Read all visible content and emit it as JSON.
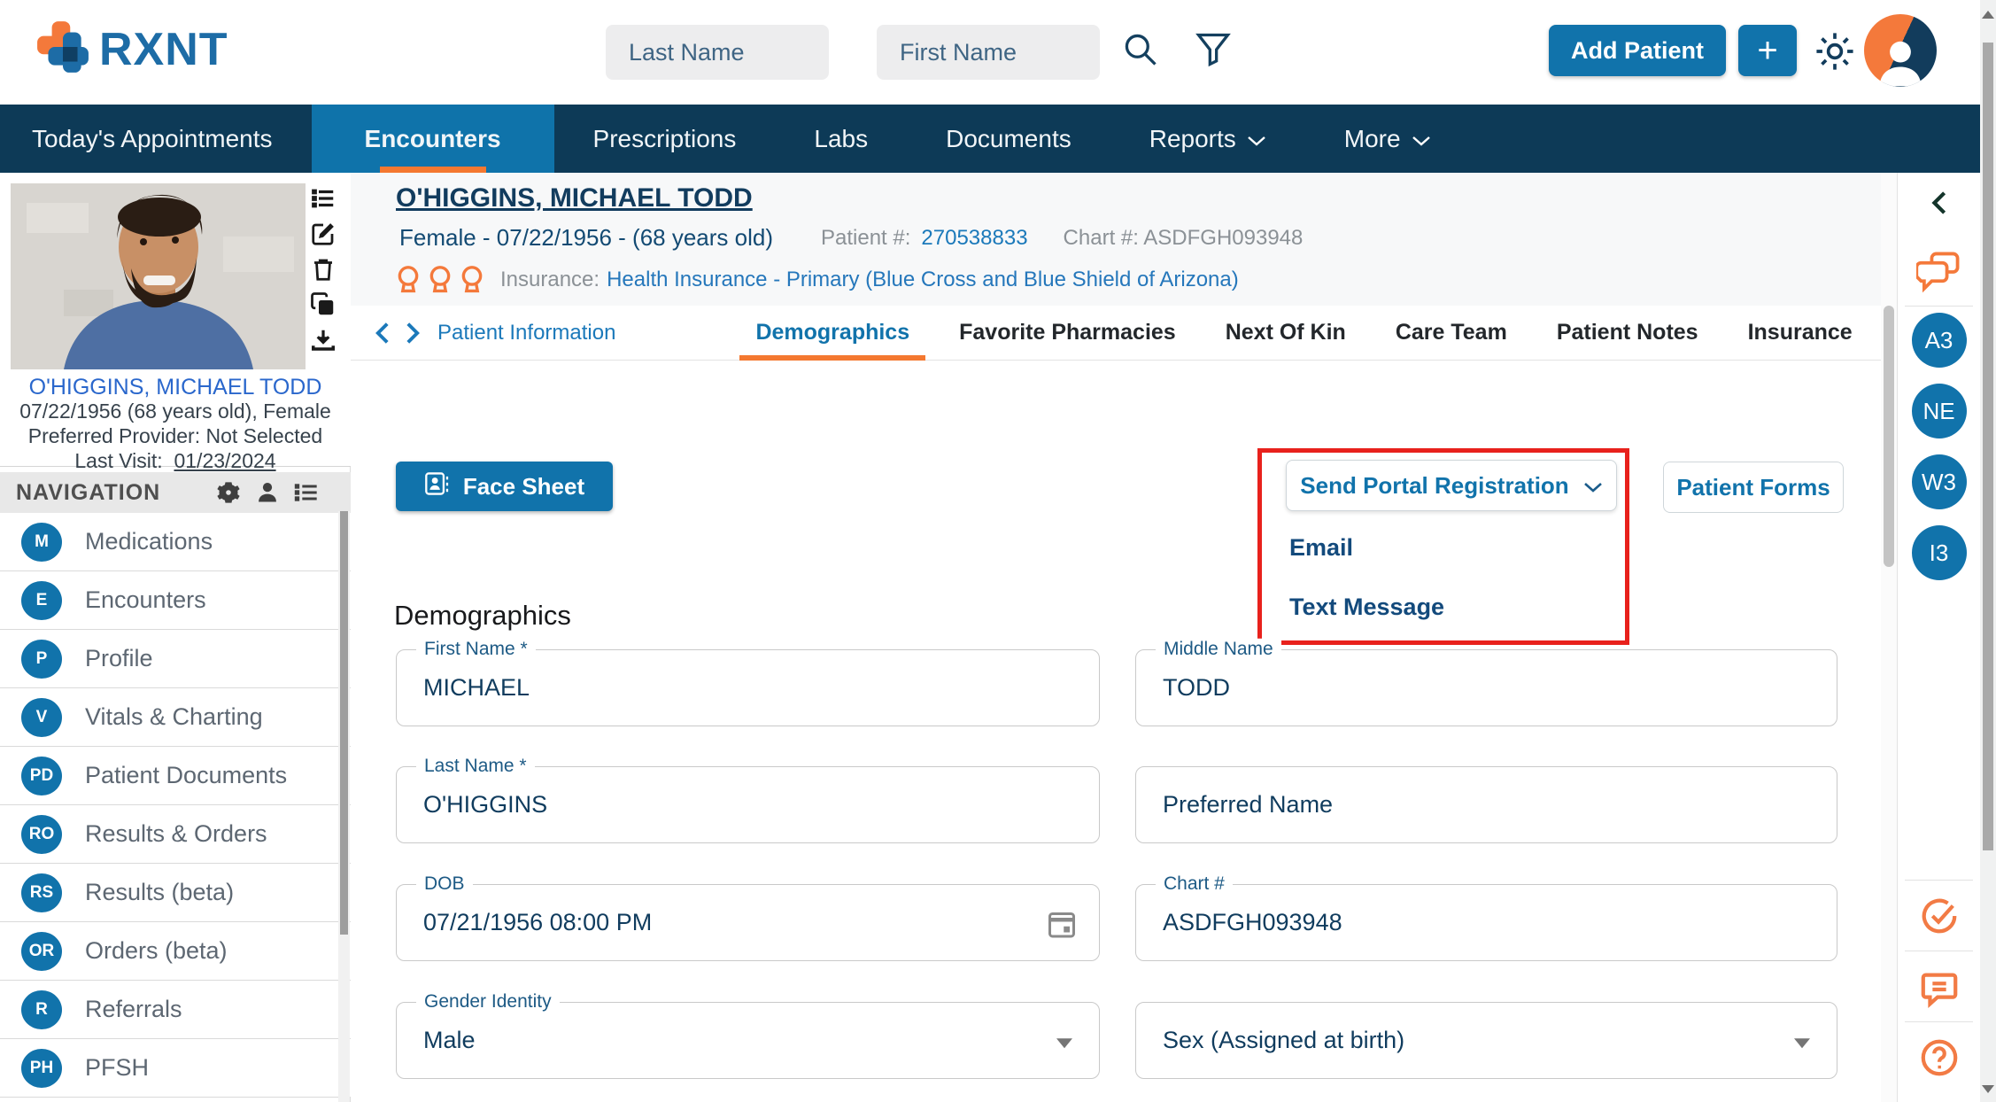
{
  "colors": {
    "navy": "#0d3a57",
    "active_tab": "#0f73aa",
    "brand_blue": "#1d6ca6",
    "button_blue": "#1173ab",
    "orange": "#f47830",
    "annotation_red": "#e8211c",
    "link_blue": "#1b79ba"
  },
  "header": {
    "brand": "RXNT",
    "search": {
      "last_name_placeholder": "Last Name",
      "first_name_placeholder": "First Name"
    },
    "add_patient_label": "Add Patient",
    "plus_label": "+"
  },
  "nav": {
    "items": [
      {
        "label": "Today's Appointments"
      },
      {
        "label": "Encounters"
      },
      {
        "label": "Prescriptions"
      },
      {
        "label": "Labs"
      },
      {
        "label": "Documents"
      },
      {
        "label": "Reports"
      },
      {
        "label": "More"
      }
    ]
  },
  "sidebar": {
    "patient_card": {
      "name": "O'HIGGINS, MICHAEL TODD",
      "dob_line": "07/22/1956 (68 years old), Female",
      "provider_line": "Preferred Provider: Not Selected",
      "last_visit_label": "Last Visit:",
      "last_visit_date": "01/23/2024"
    },
    "navigation_title": "NAVIGATION",
    "items": [
      {
        "badge": "M",
        "label": "Medications"
      },
      {
        "badge": "E",
        "label": "Encounters"
      },
      {
        "badge": "P",
        "label": "Profile"
      },
      {
        "badge": "V",
        "label": "Vitals & Charting"
      },
      {
        "badge": "PD",
        "label": "Patient Documents"
      },
      {
        "badge": "RO",
        "label": "Results & Orders"
      },
      {
        "badge": "RS",
        "label": "Results (beta)"
      },
      {
        "badge": "OR",
        "label": "Orders (beta)"
      },
      {
        "badge": "R",
        "label": "Referrals"
      },
      {
        "badge": "PH",
        "label": "PFSH"
      }
    ]
  },
  "patient_header": {
    "name": "O'HIGGINS, MICHAEL TODD",
    "summary": "Female - 07/22/1956 - (68 years old)",
    "patient_number_label": "Patient #:",
    "patient_number": "270538833",
    "chart_text": "Chart #: ASDFGH093948",
    "insurance_label": "Insurance:",
    "insurance_value": "Health Insurance - Primary (Blue Cross and Blue Shield of Arizona)"
  },
  "tab_row": {
    "context_label": "Patient Information",
    "tabs": [
      {
        "label": "Demographics"
      },
      {
        "label": "Favorite Pharmacies"
      },
      {
        "label": "Next Of Kin"
      },
      {
        "label": "Care Team"
      },
      {
        "label": "Patient Notes"
      },
      {
        "label": "Insurance"
      }
    ]
  },
  "content": {
    "face_sheet_label": "Face Sheet",
    "send_portal_label": "Send Portal Registration",
    "portal_menu": [
      "Email",
      "Text Message"
    ],
    "patient_forms_label": "Patient Forms",
    "section_title": "Demographics",
    "fields": {
      "first_name": {
        "label": "First Name *",
        "value": "MICHAEL"
      },
      "middle_name": {
        "label": "Middle Name",
        "value": "TODD"
      },
      "last_name": {
        "label": "Last Name *",
        "value": "O'HIGGINS"
      },
      "preferred_name": {
        "placeholder": "Preferred Name",
        "value": ""
      },
      "dob": {
        "label": "DOB",
        "value": "07/21/1956 08:00 PM"
      },
      "chart": {
        "label": "Chart #",
        "value": "ASDFGH093948"
      },
      "gender_identity": {
        "label": "Gender Identity",
        "value": "Male"
      },
      "sex": {
        "placeholder": "Sex (Assigned at birth)",
        "value": ""
      }
    }
  },
  "right_rail": {
    "badges": [
      "A3",
      "NE",
      "W3",
      "I3"
    ]
  }
}
